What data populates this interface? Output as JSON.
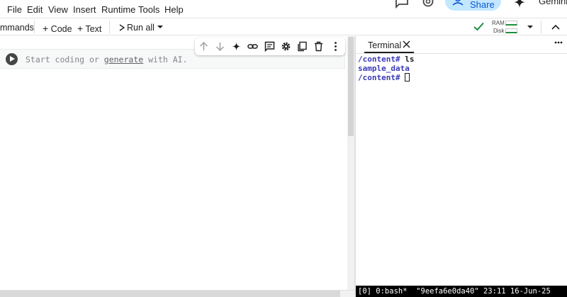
{
  "menu": {
    "items": [
      "File",
      "Edit",
      "View",
      "Insert",
      "Runtime",
      "Tools",
      "Help"
    ],
    "share_label": "Share",
    "gemini_label": "Gemini"
  },
  "toolbar": {
    "commands_label": "mmands",
    "add_code_label": "Code",
    "add_text_label": "Text",
    "run_all_label": "Run all",
    "ram_label": "RAM",
    "disk_label": "Disk",
    "status_color": "#1e8e3e"
  },
  "cell": {
    "placeholder_before": "Start coding or ",
    "placeholder_link": "generate",
    "placeholder_after": " with AI."
  },
  "cell_toolbar": {
    "icons": [
      "arrow-up-icon",
      "arrow-down-icon",
      "sparkle-icon",
      "link-icon",
      "comment-icon",
      "gear-icon",
      "mirror-cell-icon",
      "trash-icon",
      "more-vert-icon"
    ]
  },
  "terminal": {
    "tab_label": "Terminal",
    "lines": [
      {
        "prompt": "/content#",
        "cmd": " ls"
      },
      {
        "output": "sample_data"
      },
      {
        "prompt": "/content#",
        "cmd": " "
      }
    ],
    "status_bar": "[0] 0:bash*  \"9eefa6e0da40\" 23:11 16-Jun-25"
  }
}
